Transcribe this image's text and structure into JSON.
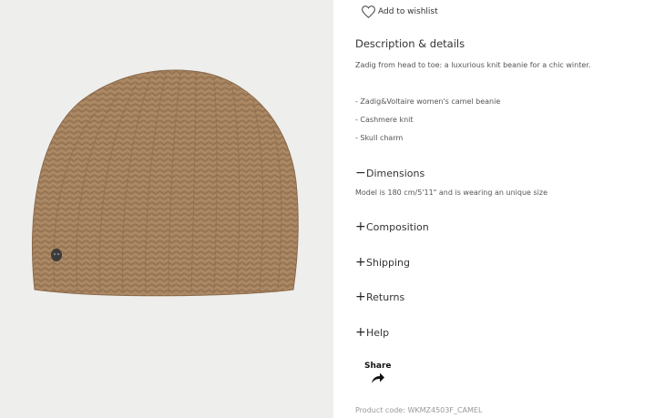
{
  "wishlist": {
    "label": "Add to wishlist",
    "icon": "heart-icon"
  },
  "description": {
    "heading": "Description & details",
    "intro": "Zadig from head to toe: a luxurious knit beanie for a chic winter.",
    "bullets": [
      "- Zadig&Voltaire women's camel beanie",
      "- Cashmere knit",
      "- Skull charm"
    ]
  },
  "sections": [
    {
      "sign": "−",
      "label": "Dimensions",
      "expanded": true
    },
    {
      "sign": "+",
      "label": "Composition",
      "expanded": false
    },
    {
      "sign": "+",
      "label": "Shipping",
      "expanded": false
    },
    {
      "sign": "+",
      "label": "Returns",
      "expanded": false
    },
    {
      "sign": "+",
      "label": "Help",
      "expanded": false
    }
  ],
  "dimensions_text": "Model is 180 cm/5'11\" and is wearing an unique size",
  "share": {
    "label": "Share",
    "icon": "share-arrow-icon"
  },
  "product_code": "Product code: WKMZ4503F_CAMEL",
  "colors": {
    "beanie": "#a5825f",
    "photo_bg": "#eeeeec"
  }
}
